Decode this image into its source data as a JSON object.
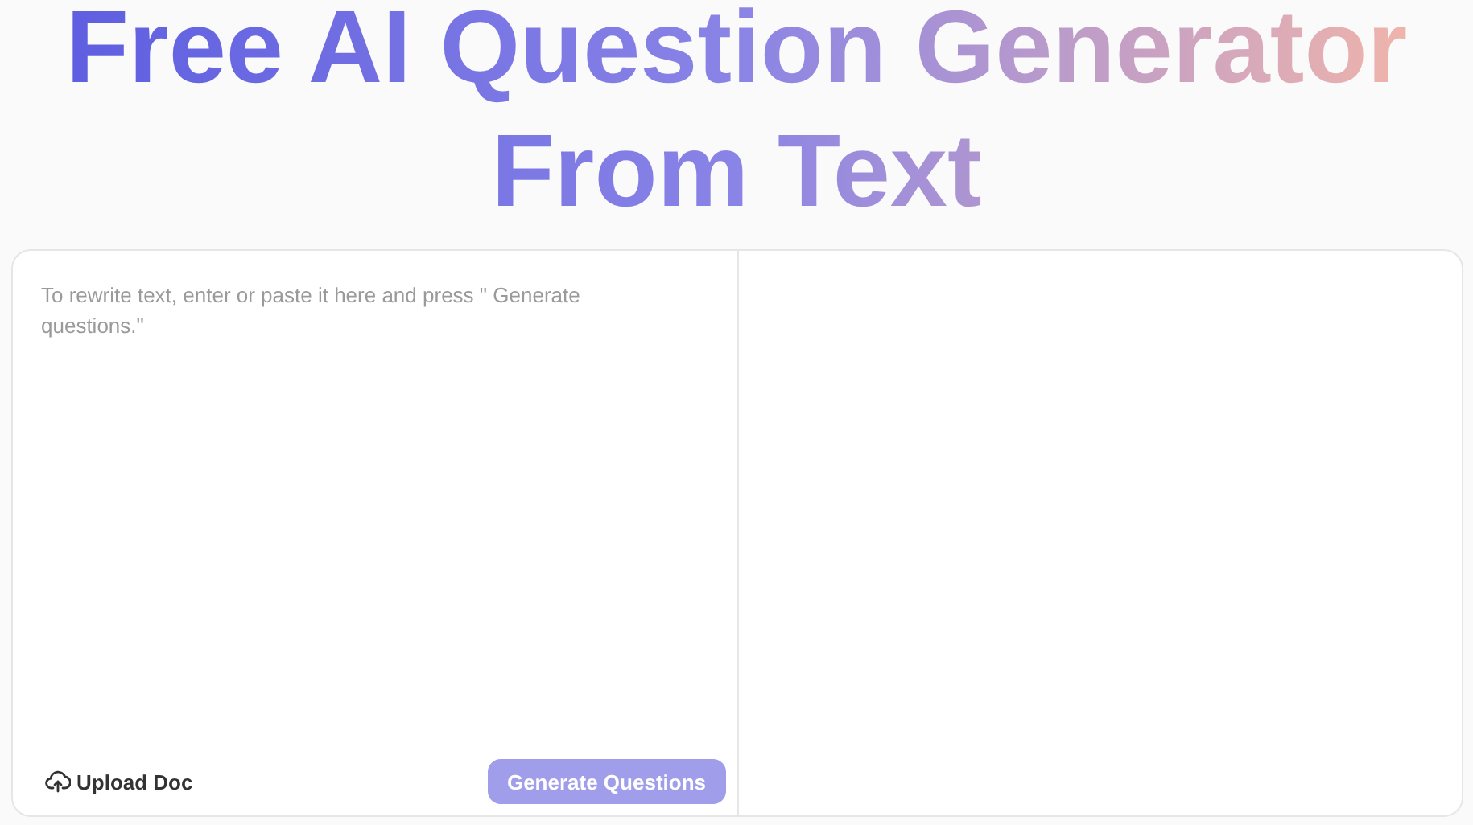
{
  "heading": "Free AI Question Generator From Text",
  "input": {
    "placeholder": "To rewrite text, enter or paste it here and press \" Generate questions.\""
  },
  "upload_button": {
    "label": "Upload Doc"
  },
  "generate_button": {
    "label": "Generate Questions",
    "disabled": true
  }
}
